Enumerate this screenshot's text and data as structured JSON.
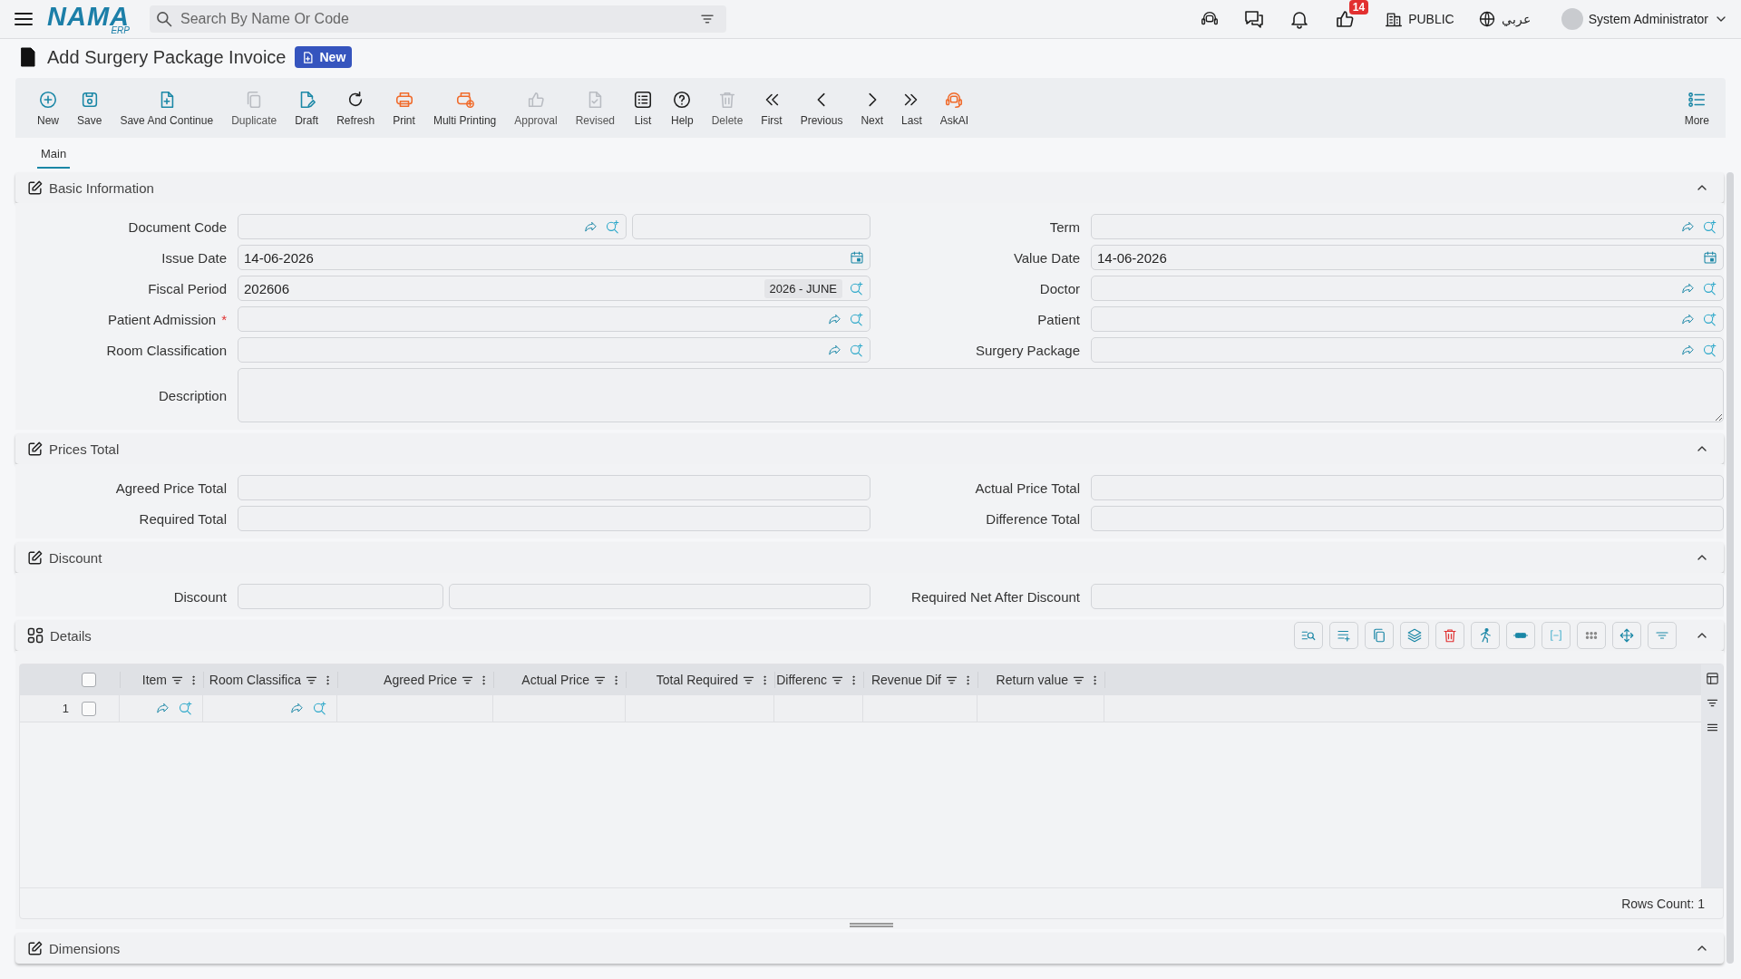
{
  "header": {
    "logo": {
      "name": "NAMA",
      "sub": "ERP"
    },
    "search": {
      "placeholder": "Search By Name Or Code"
    },
    "notification_count": "14",
    "company": "PUBLIC",
    "language": "عربي",
    "user": "System Administrator"
  },
  "page": {
    "title": "Add Surgery Package Invoice",
    "status": "New"
  },
  "toolbar": [
    {
      "kind": "new",
      "label": "New",
      "disabled": false
    },
    {
      "kind": "save",
      "label": "Save",
      "disabled": false
    },
    {
      "kind": "save-continue",
      "label": "Save And Continue",
      "disabled": false
    },
    {
      "kind": "duplicate",
      "label": "Duplicate",
      "disabled": true
    },
    {
      "kind": "draft",
      "label": "Draft",
      "disabled": false
    },
    {
      "kind": "refresh",
      "label": "Refresh",
      "disabled": false
    },
    {
      "kind": "print",
      "label": "Print",
      "disabled": false
    },
    {
      "kind": "multi-print",
      "label": "Multi Printing",
      "disabled": false
    },
    {
      "kind": "approval",
      "label": "Approval",
      "disabled": true
    },
    {
      "kind": "revised",
      "label": "Revised",
      "disabled": true
    },
    {
      "kind": "list",
      "label": "List",
      "disabled": false
    },
    {
      "kind": "help",
      "label": "Help",
      "disabled": false
    },
    {
      "kind": "delete",
      "label": "Delete",
      "disabled": true
    },
    {
      "kind": "first",
      "label": "First",
      "disabled": false
    },
    {
      "kind": "previous",
      "label": "Previous",
      "disabled": false
    },
    {
      "kind": "next",
      "label": "Next",
      "disabled": false
    },
    {
      "kind": "last",
      "label": "Last",
      "disabled": false
    },
    {
      "kind": "askai",
      "label": "AskAI",
      "disabled": false
    },
    {
      "kind": "more",
      "label": "More",
      "disabled": false
    }
  ],
  "tabs": [
    {
      "label": "Main",
      "selected": true
    }
  ],
  "sections": [
    {
      "kind": "form",
      "title": "Basic Information",
      "expanded": true,
      "fields": [
        {
          "label": "Document Code",
          "kind": "lookup-split"
        },
        {
          "label": "Term",
          "kind": "lookup"
        },
        {
          "label": "Issue Date",
          "kind": "date",
          "value": "14-06-2026"
        },
        {
          "label": "Value Date",
          "kind": "date",
          "value": "14-06-2026"
        },
        {
          "label": "Fiscal Period",
          "kind": "period",
          "value": "202606",
          "period": "2026 - JUNE"
        },
        {
          "label": "Doctor",
          "kind": "lookup"
        },
        {
          "label": "Patient Admission",
          "kind": "lookup",
          "required_mark": "*"
        },
        {
          "label": "Patient",
          "kind": "lookup"
        },
        {
          "label": "Room Classification",
          "kind": "lookup"
        },
        {
          "label": "Surgery Package",
          "kind": "lookup"
        },
        {
          "label": "Description",
          "kind": "textarea"
        }
      ]
    },
    {
      "kind": "form",
      "title": "Prices Total",
      "expanded": true,
      "fields": [
        {
          "label": "Agreed Price Total",
          "kind": "text"
        },
        {
          "label": "Actual Price Total",
          "kind": "text"
        },
        {
          "label": "Required Total",
          "kind": "text"
        },
        {
          "label": "Difference Total",
          "kind": "text"
        }
      ]
    },
    {
      "kind": "form",
      "title": "Discount",
      "expanded": true,
      "fields": [
        {
          "label": "Discount",
          "kind": "split"
        },
        {
          "label": "Required Net After Discount",
          "kind": "text"
        }
      ]
    },
    {
      "kind": "grid",
      "title": "Details",
      "expanded": true,
      "all_checked": false,
      "columns": [
        {
          "label": "Item",
          "kind": "lookup"
        },
        {
          "label": "Room Classifica",
          "kind": "lookup"
        },
        {
          "label": "Agreed Price",
          "kind": "plain"
        },
        {
          "label": "Actual Price",
          "kind": "plain"
        },
        {
          "label": "Total Required",
          "kind": "plain"
        },
        {
          "label": "Differenc",
          "kind": "plain"
        },
        {
          "label": "Revenue Dif",
          "kind": "plain"
        },
        {
          "label": "Return value",
          "kind": "plain"
        }
      ],
      "rows": [
        {
          "number": "1",
          "checked": false
        }
      ],
      "footer": "Rows Count: 1"
    },
    {
      "kind": "form",
      "title": "Dimensions",
      "expanded": true
    }
  ]
}
